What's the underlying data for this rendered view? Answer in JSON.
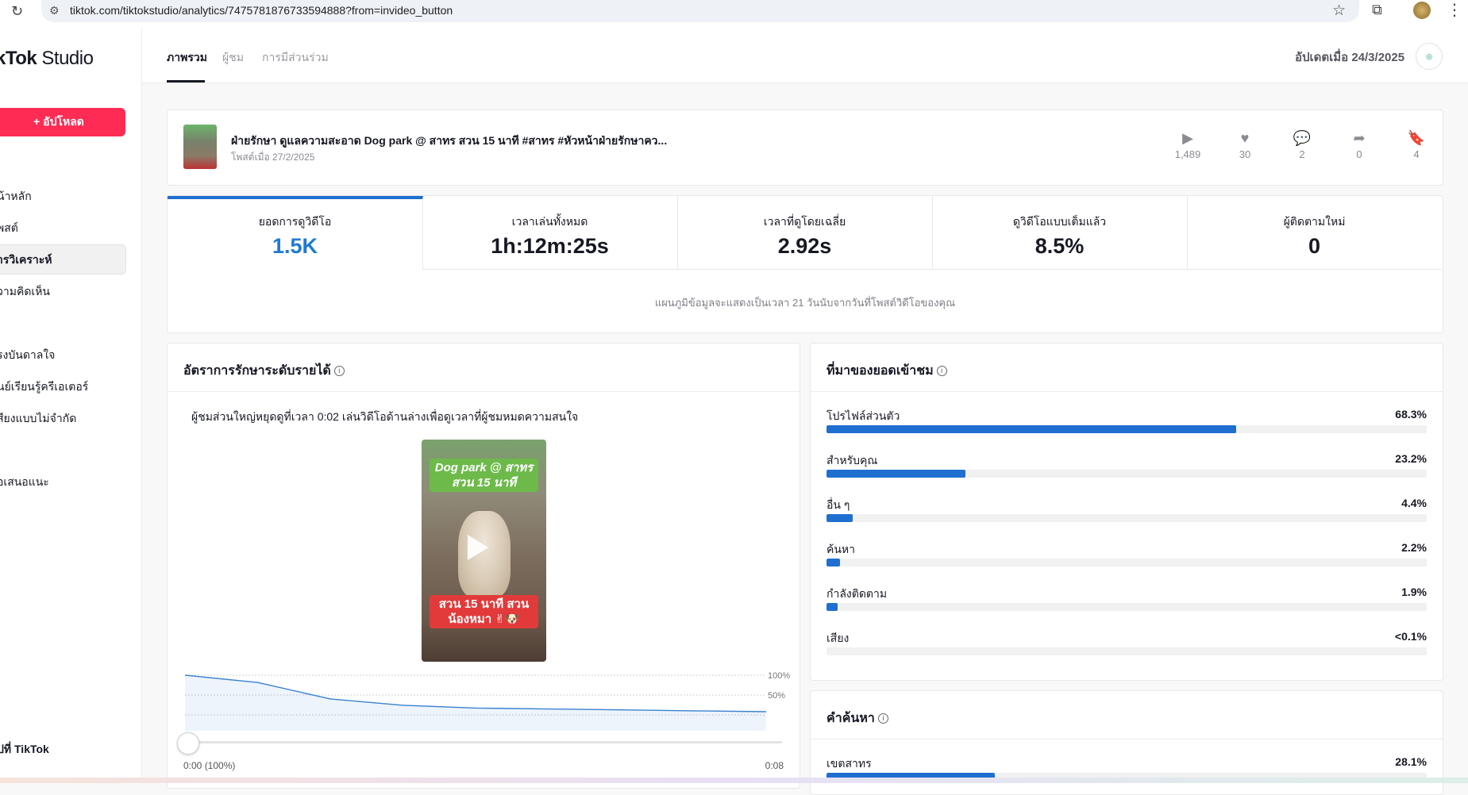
{
  "browser": {
    "url": "tiktok.com/tiktokstudio/analytics/7475781876733594888?from=invideo_button"
  },
  "sidebar": {
    "logo_brand": "kTok",
    "logo_suffix": " Studio",
    "upload_label": "+ อัปโหลด",
    "items": [
      {
        "label": "น้าหลัก"
      },
      {
        "label": "พสต์"
      },
      {
        "label": "ารวิเคราะห์"
      },
      {
        "label": "วามคิดเห็น"
      },
      {
        "label": "รงบันดาลใจ"
      },
      {
        "label": "นย์เรียนรู้ครีเอเตอร์"
      },
      {
        "label": "สียงแบบไม่จำกัด"
      },
      {
        "label": "อเสนอแนะ"
      },
      {
        "label": "ปที่ TikTok"
      }
    ]
  },
  "header": {
    "tabs": [
      {
        "label": "ภาพรวม"
      },
      {
        "label": "ผู้ชม"
      },
      {
        "label": "การมีส่วนร่วม"
      }
    ],
    "updated": "อัปเดตเมื่อ 24/3/2025"
  },
  "video": {
    "title": "ฝ่ายรักษา ดูแลความสะอาด Dog park @ สาทร สวน 15 นาที #สาทร #หัวหน้าฝ่ายรักษาคว...",
    "posted": "โพสต์เมื่อ 27/2/2025",
    "stats": {
      "plays": "1,489",
      "likes": "30",
      "comments": "2",
      "shares": "0",
      "saves": "4"
    }
  },
  "metrics": [
    {
      "label": "ยอดการดูวิดีโอ",
      "value": "1.5K"
    },
    {
      "label": "เวลาเล่นทั้งหมด",
      "value": "1h:12m:25s"
    },
    {
      "label": "เวลาที่ดูโดยเฉลี่ย",
      "value": "2.92s"
    },
    {
      "label": "ดูวิดีโอแบบเต็มแล้ว",
      "value": "8.5%"
    },
    {
      "label": "ผู้ติดตามใหม่",
      "value": "0"
    }
  ],
  "metrics_note": "แผนภูมิข้อมูลจะแสดงเป็นเวลา 21 วันนับจากวันที่โพสต์วิดีโอของคุณ",
  "retention": {
    "title": "อัตราการรักษาระดับรายได้",
    "note": "ผู้ชมส่วนใหญ่หยุดดูที่เวลา 0:02 เล่นวิดีโอด้านล่างเพื่อดูเวลาที่ผู้ชมหมดความสนใจ",
    "preview_top": "Dog park @ สาทร สวน 15 นาที",
    "preview_bottom": "สวน 15 นาที สวนน้องหมา ✌🐶",
    "time_start": "0:00 (100%)",
    "time_end": "0:08",
    "chart_data": {
      "type": "area",
      "x_start": "0:00",
      "x_end": "0:08",
      "y_ticks": [
        "100%",
        "50%"
      ],
      "x": [
        0,
        1,
        2,
        3,
        4,
        5,
        6,
        7,
        8
      ],
      "y": [
        100,
        92,
        74,
        67,
        64,
        63,
        62,
        61,
        60
      ],
      "ylim": [
        0,
        100
      ]
    }
  },
  "traffic": {
    "title": "ที่มาของยอดเข้าชม",
    "sources": [
      {
        "name": "โปรไฟล์ส่วนตัว",
        "pct": "68.3%",
        "value": 68.3
      },
      {
        "name": "สำหรับคุณ",
        "pct": "23.2%",
        "value": 23.2
      },
      {
        "name": "อื่น ๆ",
        "pct": "4.4%",
        "value": 4.4
      },
      {
        "name": "ค้นหา",
        "pct": "2.2%",
        "value": 2.2
      },
      {
        "name": "กำลังติดตาม",
        "pct": "1.9%",
        "value": 1.9
      },
      {
        "name": "เสียง",
        "pct": "<0.1%",
        "value": 0.1
      }
    ]
  },
  "search_terms": {
    "title": "คำค้นหา",
    "items": [
      {
        "name": "เขตสาทร",
        "pct": "28.1%",
        "value": 28.1
      }
    ]
  },
  "colors": {
    "accent": "#1f6fd1",
    "brand": "#fe2c55"
  }
}
